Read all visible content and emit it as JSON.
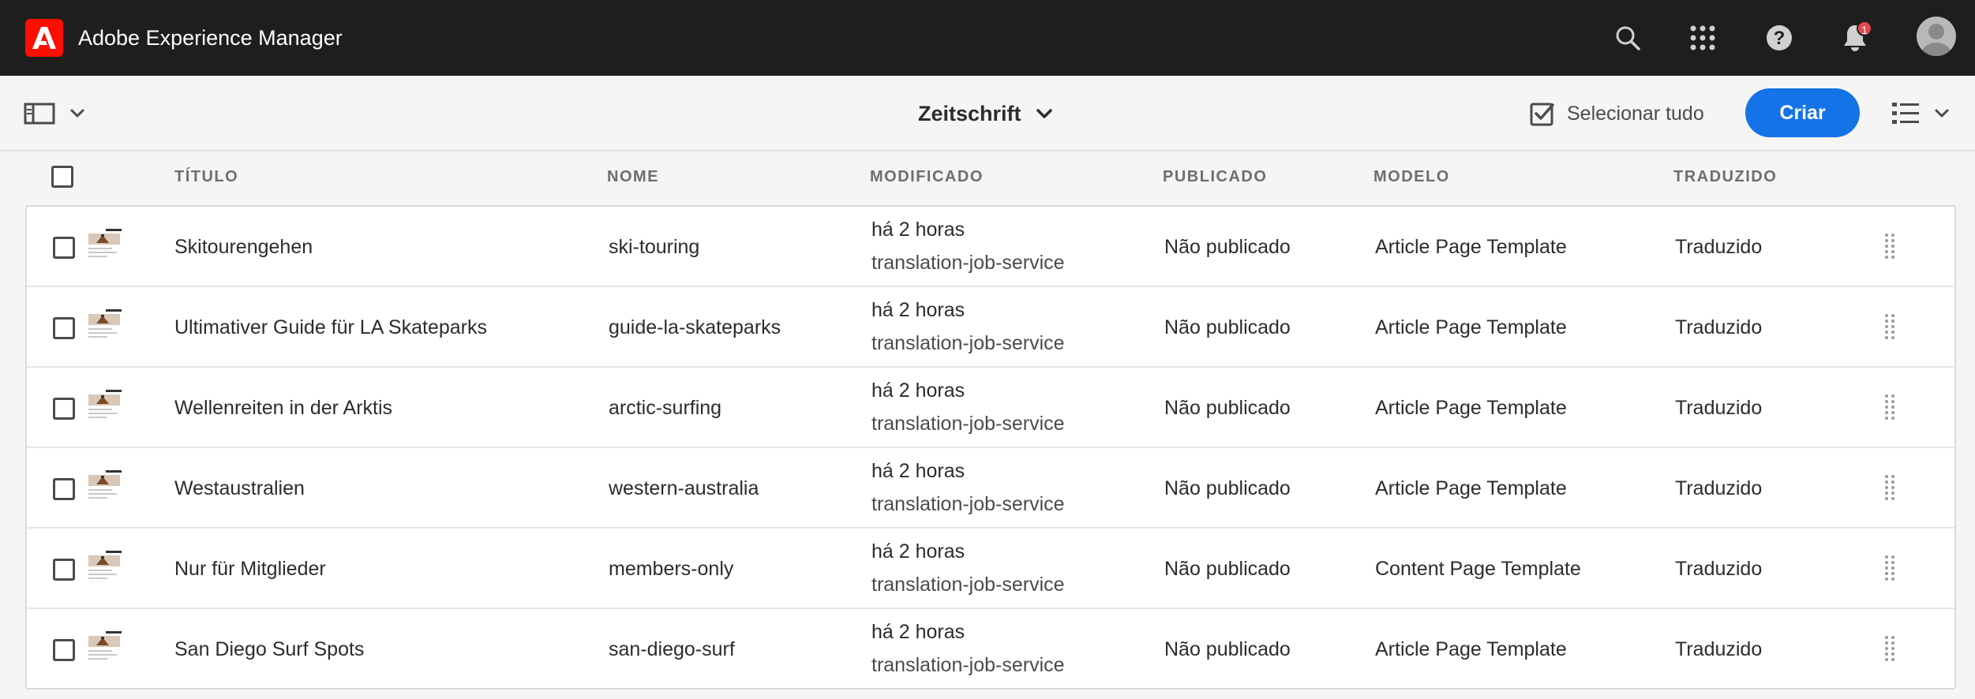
{
  "header": {
    "app_title": "Adobe Experience Manager",
    "notification_count": "1",
    "icons": [
      "adobe-logo-icon",
      "search-icon",
      "apps-grid-icon",
      "help-icon",
      "bell-icon",
      "avatar-icon"
    ]
  },
  "actionbar": {
    "breadcrumb": "Zeitschrift",
    "select_all": "Selecionar tudo",
    "create": "Criar"
  },
  "columns": {
    "title": "TÍTULO",
    "name": "NOME",
    "modified": "MODIFICADO",
    "published": "PUBLICADO",
    "template": "MODELO",
    "translated": "TRADUZIDO"
  },
  "rows": [
    {
      "title": "Skitourengehen",
      "name": "ski-touring",
      "modified": "há 2 horas",
      "modified_by": "translation-job-service",
      "published": "Não publicado",
      "template": "Article Page Template",
      "translated": "Traduzido"
    },
    {
      "title": "Ultimativer Guide für LA Skateparks",
      "name": "guide-la-skateparks",
      "modified": "há 2 horas",
      "modified_by": "translation-job-service",
      "published": "Não publicado",
      "template": "Article Page Template",
      "translated": "Traduzido"
    },
    {
      "title": "Wellenreiten in der Arktis",
      "name": "arctic-surfing",
      "modified": "há 2 horas",
      "modified_by": "translation-job-service",
      "published": "Não publicado",
      "template": "Article Page Template",
      "translated": "Traduzido"
    },
    {
      "title": "Westaustralien",
      "name": "western-australia",
      "modified": "há 2 horas",
      "modified_by": "translation-job-service",
      "published": "Não publicado",
      "template": "Article Page Template",
      "translated": "Traduzido"
    },
    {
      "title": "Nur für Mitglieder",
      "name": "members-only",
      "modified": "há 2 horas",
      "modified_by": "translation-job-service",
      "published": "Não publicado",
      "template": "Content Page Template",
      "translated": "Traduzido"
    },
    {
      "title": "San Diego Surf Spots",
      "name": "san-diego-surf",
      "modified": "há 2 horas",
      "modified_by": "translation-job-service",
      "published": "Não publicado",
      "template": "Article Page Template",
      "translated": "Traduzido"
    }
  ],
  "colors": {
    "header_bg": "#1e1e1e",
    "brand_red": "#fa0f00",
    "accent_blue": "#1473e6",
    "badge_red": "#e34850"
  }
}
